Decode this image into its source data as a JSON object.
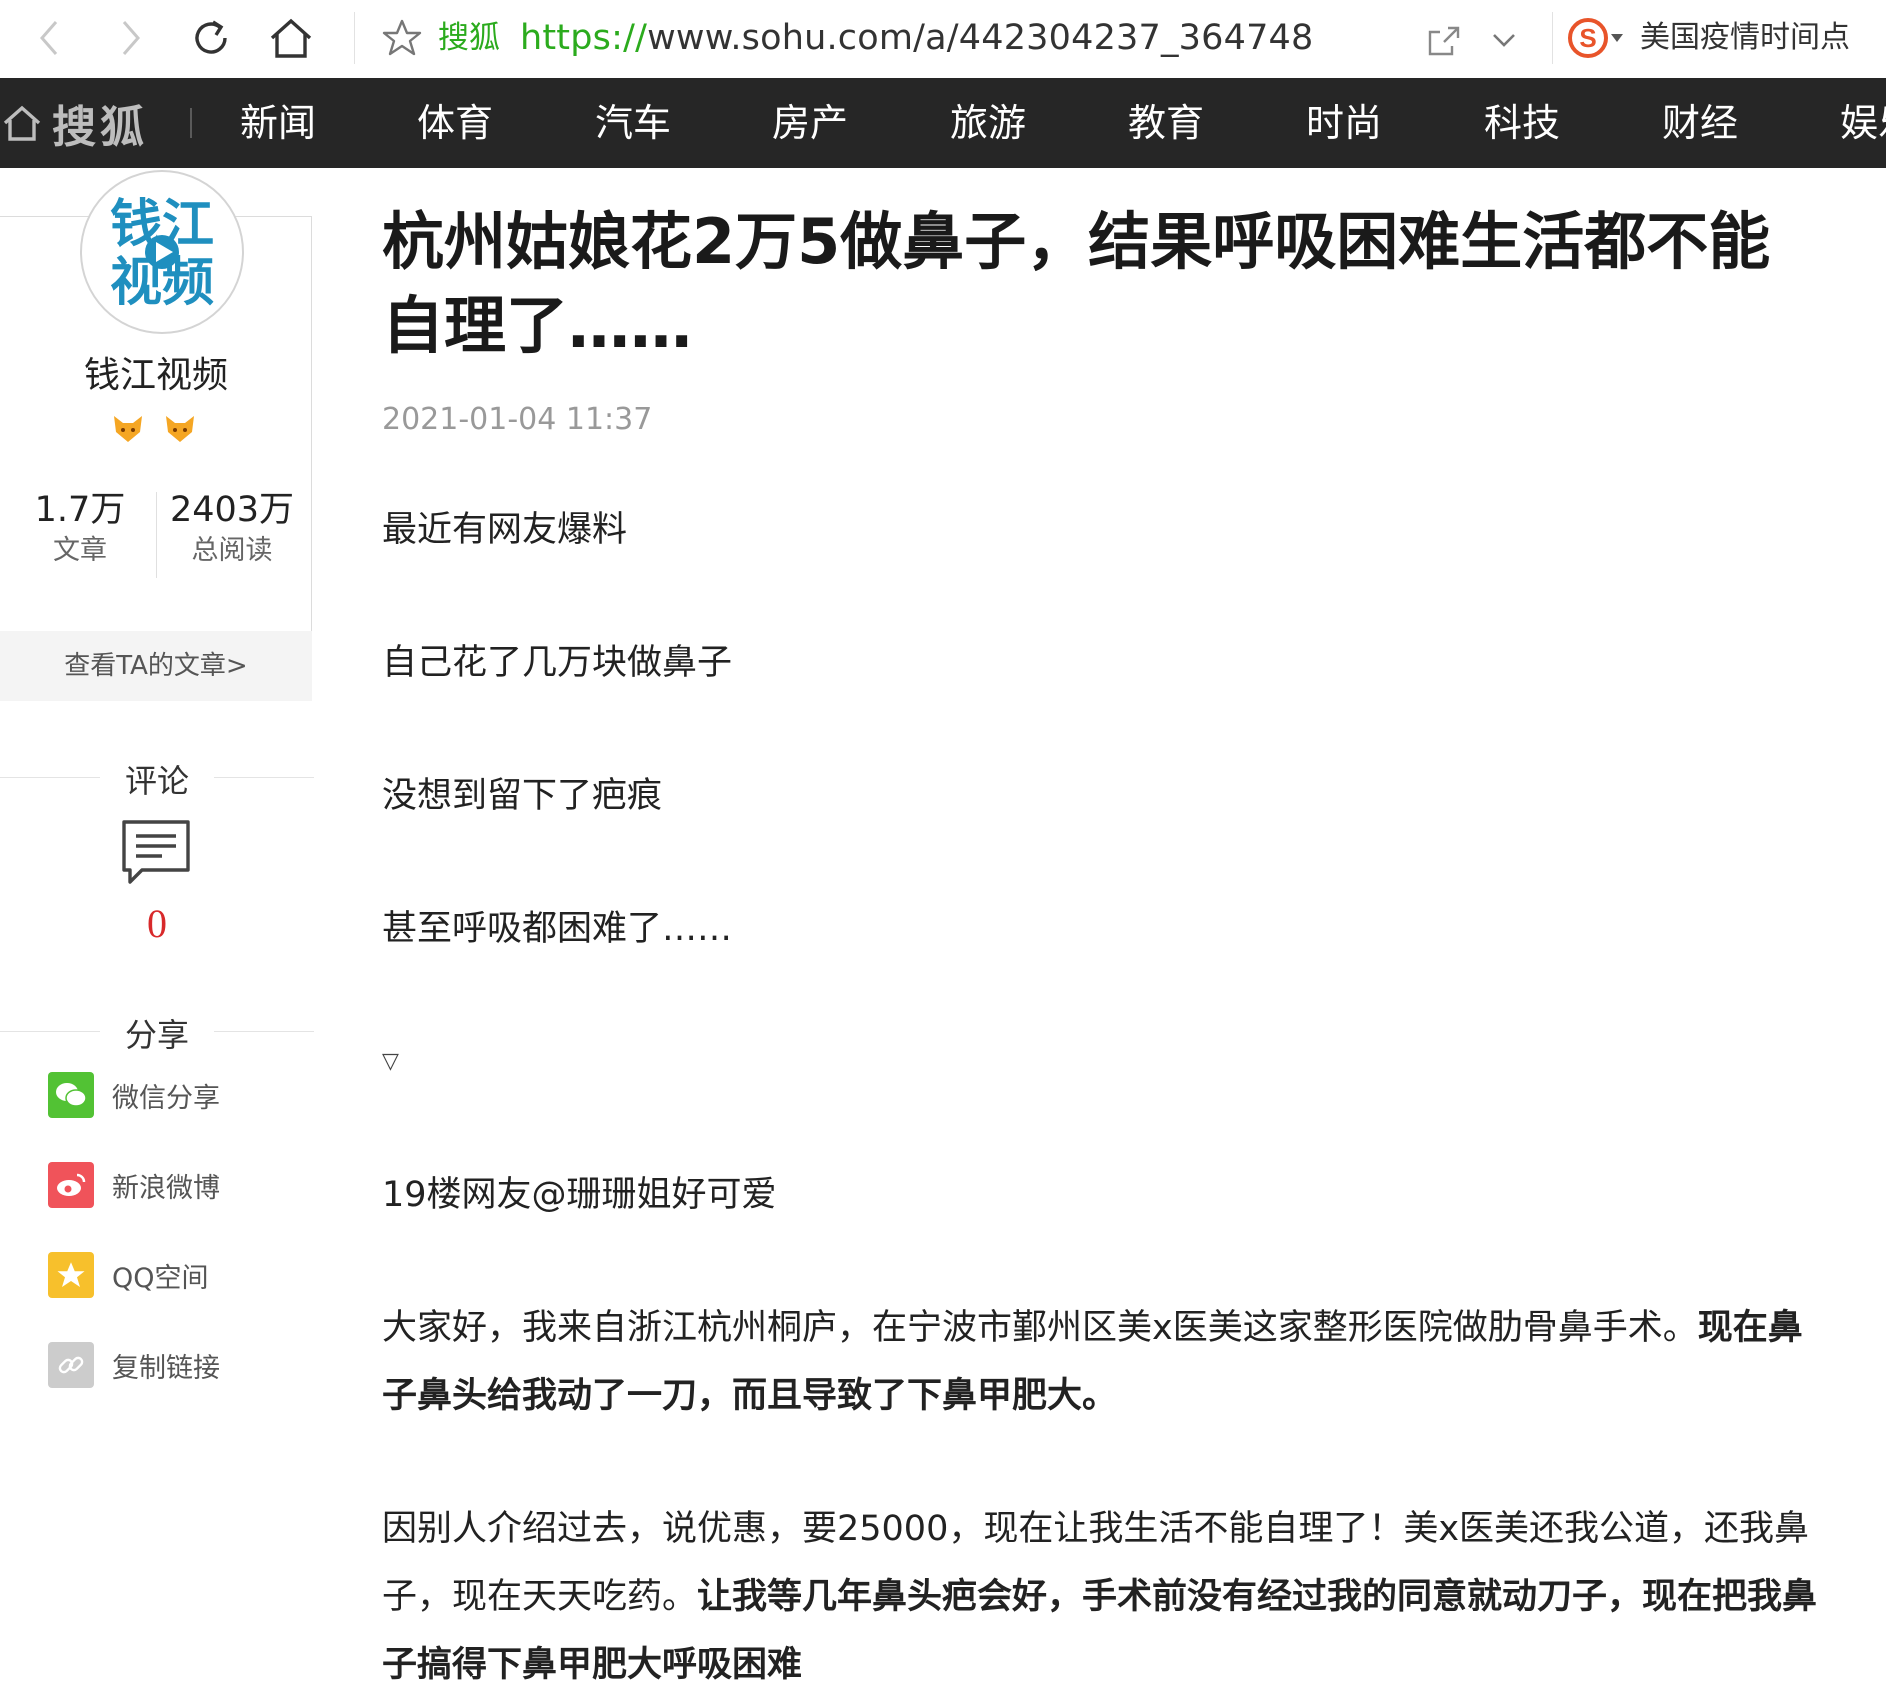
{
  "browser": {
    "site_name": "搜狐",
    "url_protocol": "https://",
    "url_rest": "www.sohu.com/a/442304237_364748",
    "hot_search": "美国疫情时间点",
    "icons": [
      "back-icon",
      "forward-icon",
      "refresh-icon",
      "home-icon",
      "bookmark-star-icon",
      "share-icon",
      "chevron-down-icon",
      "sogou-search-icon"
    ]
  },
  "topnav": {
    "logo": "搜狐",
    "items": [
      "新闻",
      "体育",
      "汽车",
      "房产",
      "旅游",
      "教育",
      "时尚",
      "科技",
      "财经",
      "娱乐"
    ]
  },
  "author": {
    "name": "钱江视频",
    "avatar_text": "钱江视频",
    "articles_num": "1.7万",
    "articles_label": "文章",
    "reads_num": "2403万",
    "reads_label": "总阅读",
    "view_articles": "查看TA的文章>"
  },
  "comments": {
    "title": "评论",
    "count": "0"
  },
  "share": {
    "title": "分享",
    "items": [
      {
        "label": "微信分享",
        "color": "#52c234"
      },
      {
        "label": "新浪微博",
        "color": "#f0535a"
      },
      {
        "label": "QQ空间",
        "color": "#f7c02c"
      },
      {
        "label": "复制链接",
        "color": "#cccccc"
      }
    ]
  },
  "article": {
    "title": "杭州姑娘花2万5做鼻子，结果呼吸困难生活都不能自理了……",
    "date": "2021-01-04 11:37",
    "p1": "最近有网友爆料",
    "p2": "自己花了几万块做鼻子",
    "p3": "没想到留下了疤痕",
    "p4": "甚至呼吸都困难了……",
    "p5": "▽",
    "p6": "19楼网友@珊珊姐好可爱",
    "p7_normal": "大家好，我来自浙江杭州桐庐，在宁波市鄞州区美x医美这家整形医院做肋骨鼻手术。",
    "p7_bold": "现在鼻子鼻头给我动了一刀，而且导致了下鼻甲肥大。",
    "p8_normal": "因别人介绍过去，说优惠，要25000，现在让我生活不能自理了！美x医美还我公道，还我鼻子，现在天天吃药。",
    "p8_bold": "让我等几年鼻头疤会好，手术前没有经过我的同意就动刀子，现在把我鼻子搞得下鼻甲肥大呼吸困难"
  },
  "colors": {
    "accent_green": "#2bab1d",
    "nav_bg": "#262626",
    "comment_red": "#d8292b"
  }
}
